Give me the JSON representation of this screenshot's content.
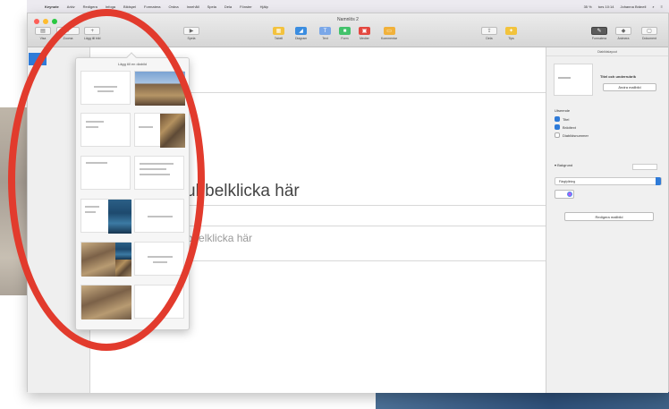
{
  "menubar": {
    "app_name": "Keynote",
    "items": [
      "Arkiv",
      "Redigera",
      "Infoga",
      "Bildspel",
      "Formatera",
      "Ordna",
      "Innehåll",
      "Spela",
      "Dela",
      "Fönster",
      "Hjälp"
    ],
    "status": [
      "35 %",
      "tors 10:14",
      "Johanna Bränell"
    ]
  },
  "window": {
    "title": "Namnlös 2",
    "traffic_lights": [
      "#fd5f57",
      "#febc2e",
      "#28c840"
    ],
    "toolbar": {
      "view": "Visa",
      "zoom": "Zooma",
      "add_slide": "Lägg till bild",
      "play": "Spela",
      "table": "Tabell",
      "chart": "Diagram",
      "text": "Text",
      "shape": "Form",
      "media": "Medier",
      "comment": "Kommentar",
      "share": "Dela",
      "tips": "Tips",
      "format": "Formatera",
      "animate": "Animera",
      "document": "Dokument"
    }
  },
  "popover": {
    "header": "Lägg till en diabild"
  },
  "slide": {
    "title_placeholder": "ubbelklicka här",
    "body_placeholder": "ubbelklicka här"
  },
  "inspector": {
    "tab": "Diabildslayout",
    "layout_name": "Titel och underrubrik",
    "edit_master_button": "Ändra mallbild",
    "appearance_label": "Utseende",
    "checkboxes": [
      {
        "label": "Titel",
        "checked": true
      },
      {
        "label": "Brödtext",
        "checked": true
      },
      {
        "label": "Diabildsnummer",
        "checked": false
      }
    ],
    "background_label": "Bakgrund",
    "fill_option": "Färgfyllning",
    "edit_layout_button": "Redigera mallbild"
  }
}
